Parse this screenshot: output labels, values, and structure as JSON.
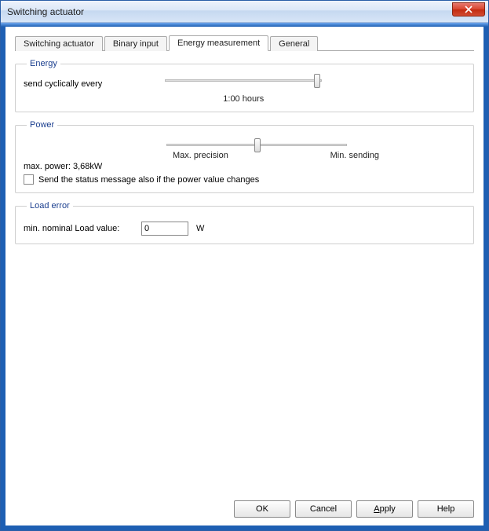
{
  "window": {
    "title": "Switching actuator"
  },
  "tabs": {
    "t0": "Switching actuator",
    "t1": "Binary input",
    "t2": "Energy measurement",
    "t3": "General"
  },
  "energy": {
    "legend": "Energy",
    "send_label": "send cyclically every",
    "value_label": "1:00 hours"
  },
  "power": {
    "legend": "Power",
    "max_precision": "Max. precision",
    "min_sending": "Min. sending",
    "max_power": "max. power: 3,68kW",
    "chk_label": "Send the status message also if the power value changes"
  },
  "load": {
    "legend": "Load error",
    "label": "min. nominal Load value:",
    "value": "0",
    "unit": "W"
  },
  "buttons": {
    "ok": "OK",
    "cancel": "Cancel",
    "apply": "Apply",
    "help": "Help"
  }
}
